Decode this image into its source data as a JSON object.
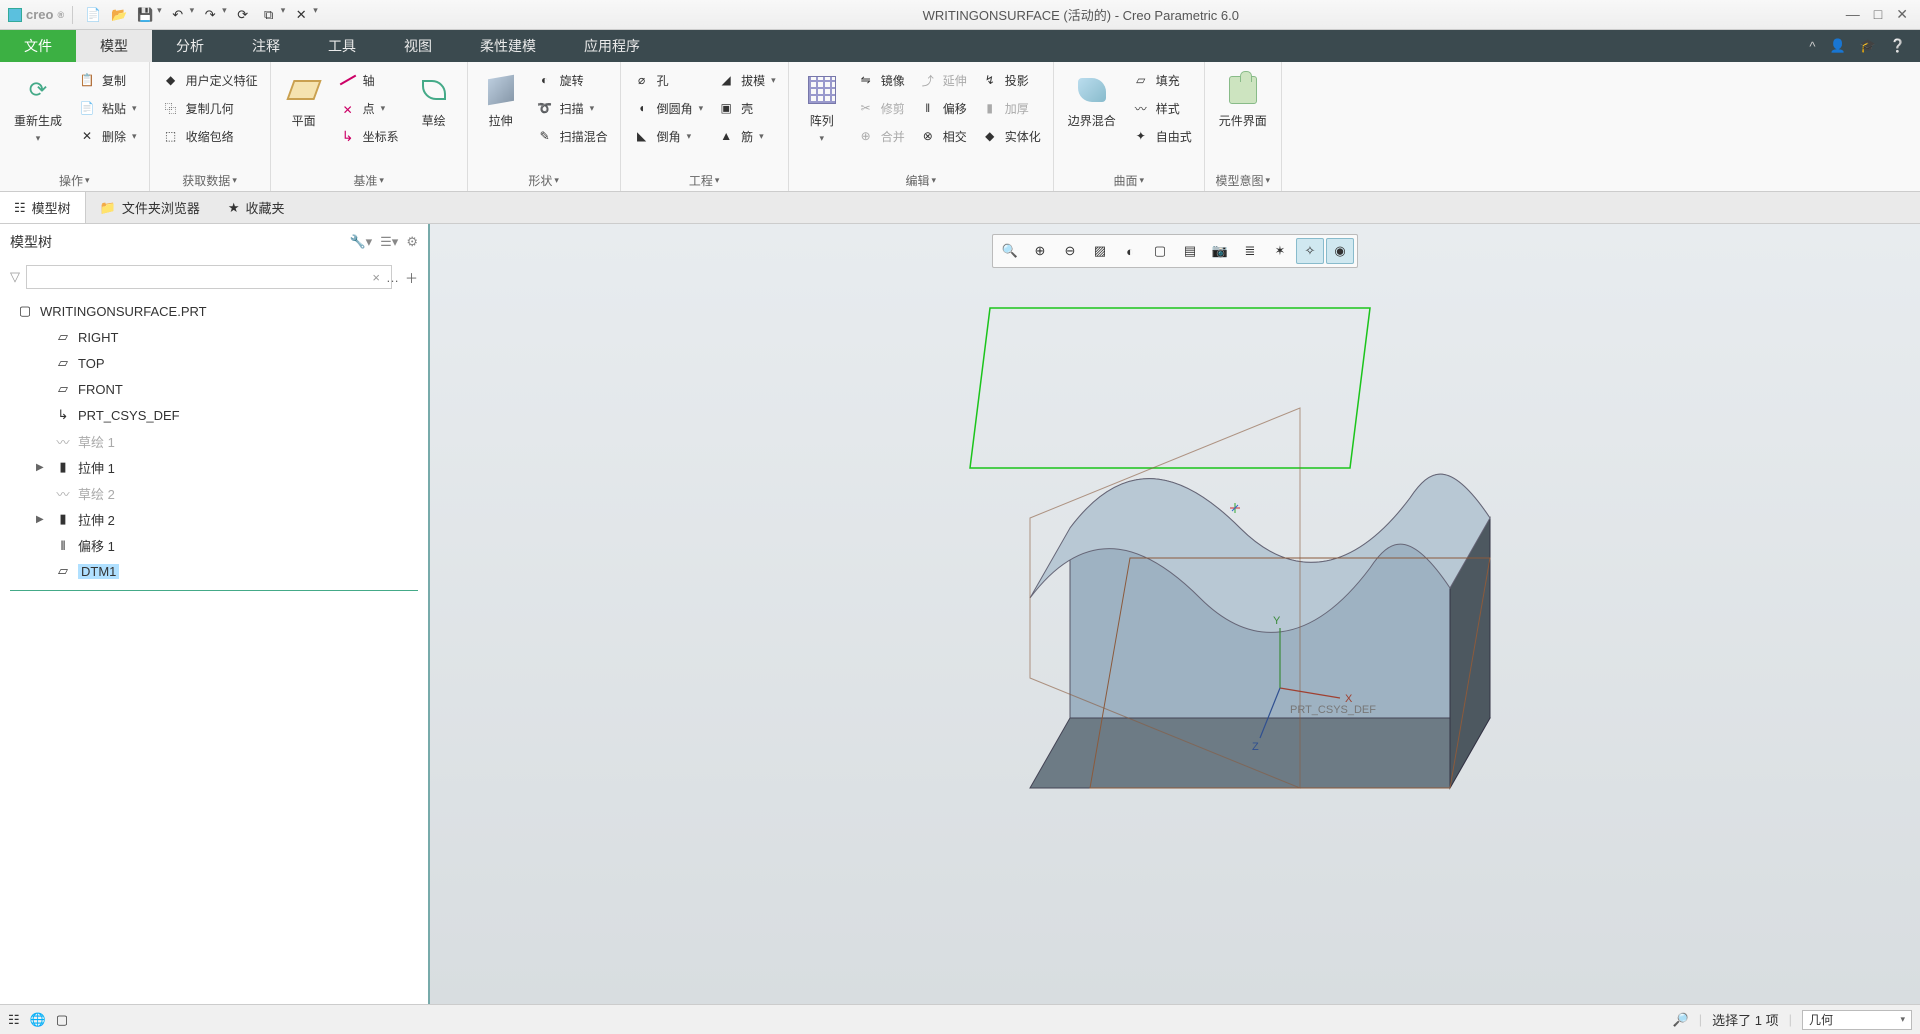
{
  "app": {
    "logo_text": "creo",
    "title": "WRITINGONSURFACE (活动的) - Creo Parametric 6.0"
  },
  "qat": [
    {
      "name": "new-icon"
    },
    {
      "name": "open-icon"
    },
    {
      "name": "save-icon"
    },
    {
      "name": "undo-icon"
    },
    {
      "name": "redo-icon"
    },
    {
      "name": "regenerate-icon"
    },
    {
      "name": "windows-icon"
    },
    {
      "name": "close-icon"
    }
  ],
  "window": {
    "min": "—",
    "max": "□",
    "close": "✕"
  },
  "tabs": {
    "file": "文件",
    "items": [
      "模型",
      "分析",
      "注释",
      "工具",
      "视图",
      "柔性建模",
      "应用程序"
    ],
    "active": 0
  },
  "ribbon": {
    "groups": {
      "operate": {
        "label": "操作",
        "regen": "重新生成",
        "copy": "复制",
        "paste": "粘贴",
        "delete": "删除"
      },
      "get_data": {
        "label": "获取数据",
        "udf": "用户定义特征",
        "copy_geom": "复制几何",
        "shrinkwrap": "收缩包络"
      },
      "datum": {
        "label": "基准",
        "plane": "平面",
        "axis": "轴",
        "point": "点",
        "csys": "坐标系",
        "sketch": "草绘"
      },
      "shape": {
        "label": "形状",
        "extrude": "拉伸",
        "revolve": "旋转",
        "sweep": "扫描",
        "sweep_blend": "扫描混合"
      },
      "engineering": {
        "label": "工程",
        "hole": "孔",
        "round": "倒圆角",
        "chamfer": "倒角",
        "draft": "拔模",
        "shell": "壳",
        "rib": "筋"
      },
      "edit": {
        "label": "编辑",
        "pattern": "阵列",
        "mirror": "镜像",
        "trim": "修剪",
        "merge": "合并",
        "extend": "延伸",
        "offset": "偏移",
        "intersect": "相交",
        "project": "投影",
        "thicken": "加厚",
        "solidify": "实体化"
      },
      "surface": {
        "label": "曲面",
        "boundary": "边界混合",
        "fill": "填充",
        "style": "样式",
        "freestyle": "自由式"
      },
      "intent": {
        "label": "模型意图",
        "component": "元件界面"
      }
    }
  },
  "panel_tabs": {
    "model_tree": "模型树",
    "folder_browser": "文件夹浏览器",
    "favorites": "收藏夹"
  },
  "tree": {
    "header": "模型树",
    "root": "WRITINGONSURFACE.PRT",
    "items": [
      {
        "label": "RIGHT",
        "icon": "plane-icon",
        "indent": 1
      },
      {
        "label": "TOP",
        "icon": "plane-icon",
        "indent": 1
      },
      {
        "label": "FRONT",
        "icon": "plane-icon",
        "indent": 1
      },
      {
        "label": "PRT_CSYS_DEF",
        "icon": "csys-icon",
        "indent": 1
      },
      {
        "label": "草绘 1",
        "icon": "sketch-icon",
        "indent": 1,
        "disabled": true
      },
      {
        "label": "拉伸 1",
        "icon": "extrude-icon",
        "indent": 1,
        "expandable": true
      },
      {
        "label": "草绘 2",
        "icon": "sketch-icon",
        "indent": 1,
        "disabled": true
      },
      {
        "label": "拉伸 2",
        "icon": "extrude-icon",
        "indent": 1,
        "expandable": true
      },
      {
        "label": "偏移 1",
        "icon": "offset-icon",
        "indent": 1
      },
      {
        "label": "DTM1",
        "icon": "plane-icon",
        "indent": 1,
        "selected": true
      }
    ]
  },
  "viewport": {
    "csys_label": "PRT_CSYS_DEF",
    "axes": {
      "x": "X",
      "y": "Y",
      "z": "Z"
    },
    "toolbar_icons": [
      "refit-icon",
      "zoom-in-icon",
      "zoom-out-icon",
      "repaint-icon",
      "style-icon",
      "display-box-icon",
      "saved-views-icon",
      "image-icon",
      "layers-icon",
      "annotations-icon",
      "spin-center-icon",
      "perspective-icon"
    ]
  },
  "status": {
    "selection_text": "选择了 1 项",
    "filter": "几何"
  }
}
